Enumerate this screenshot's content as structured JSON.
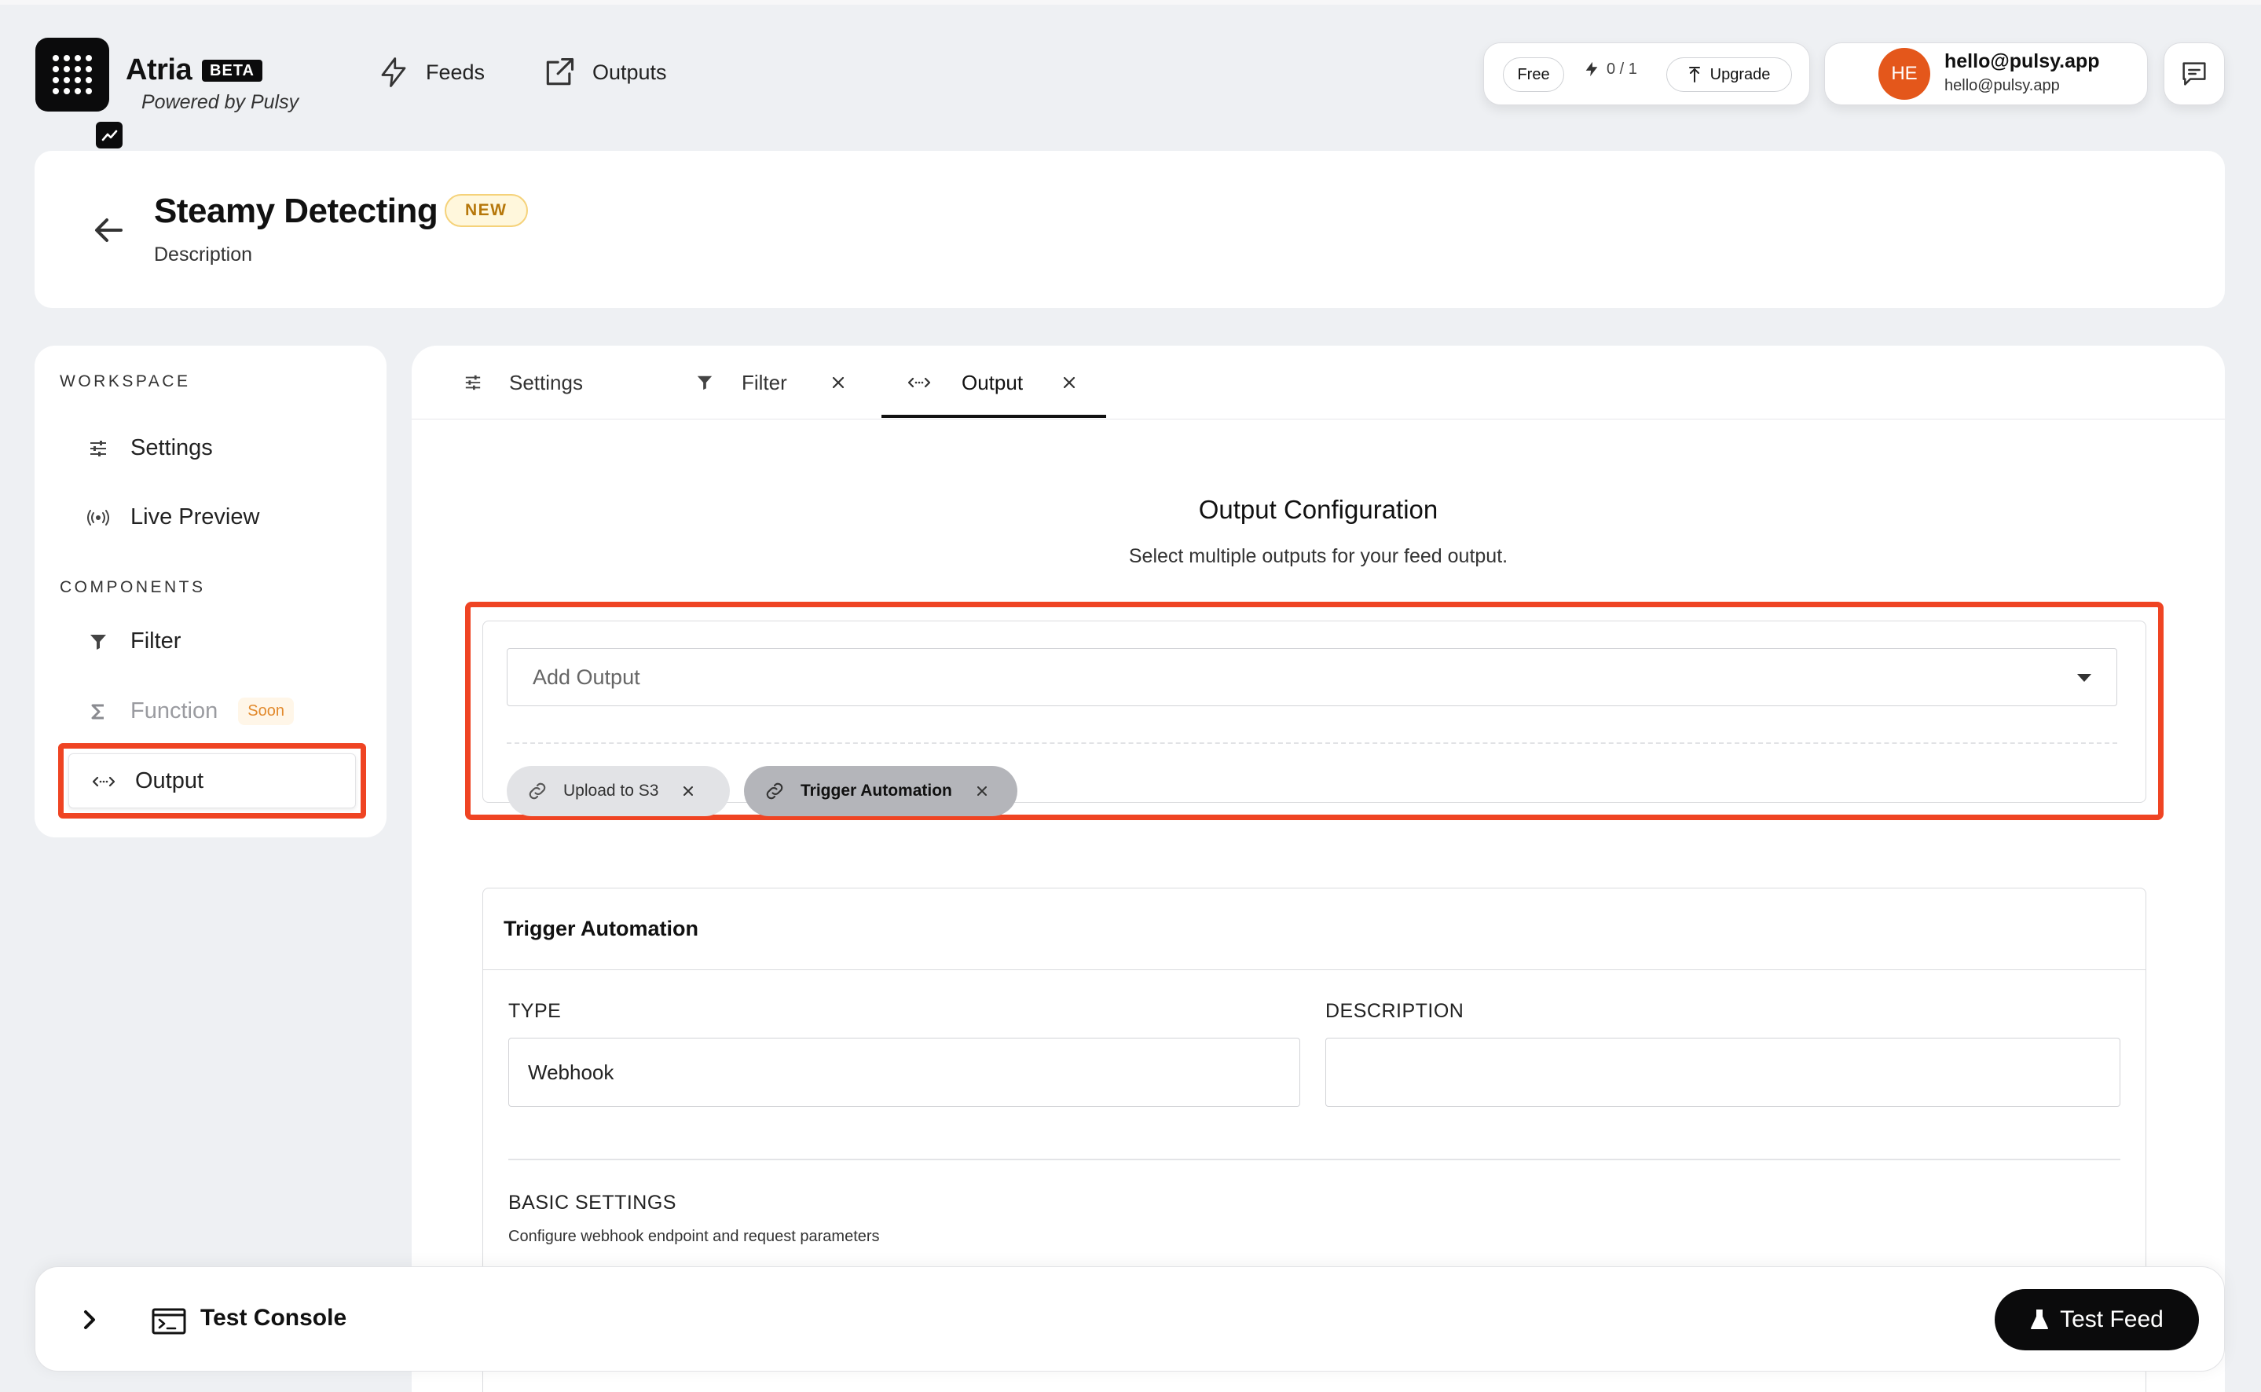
{
  "app": {
    "name": "Atria",
    "badge": "BETA",
    "powered_by": "Powered by Pulsy"
  },
  "nav": [
    {
      "label": "Feeds",
      "icon": "lightning-icon"
    },
    {
      "label": "Outputs",
      "icon": "external-link-icon"
    }
  ],
  "plan": {
    "tier": "Free",
    "usage": "0 / 1",
    "upgrade_label": "Upgrade"
  },
  "user": {
    "initials": "HE",
    "email": "hello@pulsy.app",
    "sub_email": "hello@pulsy.app"
  },
  "header": {
    "title": "Steamy Detecting",
    "badge": "NEW",
    "description": "Description"
  },
  "sidebar": {
    "workspace_label": "WORKSPACE",
    "components_label": "COMPONENTS",
    "items": [
      {
        "label": "Settings",
        "icon": "sliders-icon"
      },
      {
        "label": "Live Preview",
        "icon": "broadcast-icon"
      },
      {
        "label": "Filter",
        "icon": "filter-icon"
      },
      {
        "label": "Function",
        "icon": "sigma-icon",
        "tag": "Soon"
      },
      {
        "label": "Output",
        "icon": "code-arrows-icon",
        "active": true
      }
    ]
  },
  "tabs": [
    {
      "label": "Settings",
      "icon": "sliders-icon",
      "closable": false
    },
    {
      "label": "Filter",
      "icon": "filter-icon",
      "closable": true
    },
    {
      "label": "Output",
      "icon": "code-arrows-icon",
      "closable": true,
      "active": true
    }
  ],
  "output_config": {
    "title": "Output Configuration",
    "subtitle": "Select multiple outputs for your feed output.",
    "select_placeholder": "Add Output",
    "selected_outputs": [
      {
        "label": "Upload to S3",
        "active": false
      },
      {
        "label": "Trigger Automation",
        "active": true
      }
    ]
  },
  "trigger_automation": {
    "title": "Trigger Automation",
    "type_label": "TYPE",
    "type_value": "Webhook",
    "description_label": "DESCRIPTION",
    "description_value": "",
    "basic_settings_label": "BASIC SETTINGS",
    "basic_settings_desc": "Configure webhook endpoint and request parameters"
  },
  "console": {
    "label": "Test Console",
    "test_button": "Test Feed"
  },
  "colors": {
    "highlight": "#ef4423",
    "avatar": "#e4571b",
    "brand_dark": "#0b0b0c",
    "soon_tag": "#e28a2d",
    "new_badge": "#b6770a"
  }
}
